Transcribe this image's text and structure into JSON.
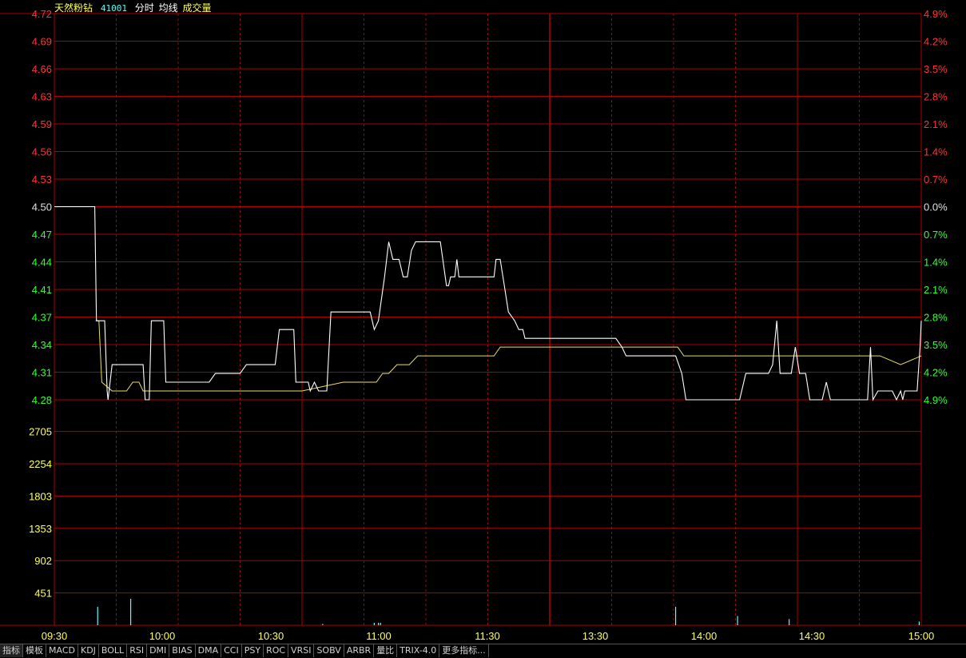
{
  "header": {
    "name": "天然粉钻",
    "code": "41001",
    "legend_intraday": "分时",
    "legend_avg": "均线",
    "legend_volume": "成交量"
  },
  "colors": {
    "grid": "#b00000",
    "price_up": "#ff3333",
    "price_down": "#33ff33",
    "base": "#e0e0e0",
    "volume_axis": "#ffff55",
    "price_line": "#ffffff",
    "avg_line": "#e8e060",
    "volume_bar": "#55ffff"
  },
  "tabs": [
    "指标",
    "模板",
    "MACD",
    "KDJ",
    "BOLL",
    "RSI",
    "DMI",
    "BIAS",
    "DMA",
    "CCI",
    "PSY",
    "ROC",
    "VRSI",
    "SOBV",
    "ARBR",
    "量比",
    "TRIX-4.0",
    "更多指标..."
  ],
  "chart_data": {
    "type": "line",
    "time_labels": [
      "09:30",
      "10:00",
      "10:30",
      "11:00",
      "11:30",
      "13:30",
      "14:00",
      "14:30",
      "15:00"
    ],
    "price_axis": {
      "ticks": [
        "4.72",
        "4.69",
        "4.66",
        "4.63",
        "4.59",
        "4.56",
        "4.53",
        "4.50",
        "4.47",
        "4.44",
        "4.41",
        "4.37",
        "4.34",
        "4.31",
        "4.28"
      ],
      "pct_ticks": [
        "4.9%",
        "4.2%",
        "3.5%",
        "2.8%",
        "2.1%",
        "1.4%",
        "0.7%",
        "0.0%",
        "0.7%",
        "1.4%",
        "2.1%",
        "2.8%",
        "3.5%",
        "4.2%",
        "4.9%"
      ],
      "base": 4.5,
      "ylim": [
        4.28,
        4.72
      ]
    },
    "volume_axis": {
      "ticks": [
        "2705",
        "2254",
        "1803",
        "1353",
        "902",
        "451"
      ],
      "ylim": [
        0,
        3156
      ]
    },
    "series": [
      {
        "values": [
          [
            0,
            4.5
          ],
          [
            9.8,
            4.5
          ],
          [
            10.2,
            4.37
          ],
          [
            12.2,
            4.37
          ],
          [
            12.8,
            4.29
          ],
          [
            13,
            4.28
          ],
          [
            14,
            4.32
          ],
          [
            21.5,
            4.32
          ],
          [
            22,
            4.28
          ],
          [
            23,
            4.28
          ],
          [
            23.5,
            4.37
          ],
          [
            26.5,
            4.37
          ],
          [
            27,
            4.3
          ],
          [
            37.5,
            4.3
          ],
          [
            39,
            4.31
          ],
          [
            45,
            4.31
          ],
          [
            46.5,
            4.32
          ],
          [
            53.5,
            4.32
          ],
          [
            54.5,
            4.36
          ],
          [
            58,
            4.36
          ],
          [
            58.5,
            4.3
          ],
          [
            61.5,
            4.3
          ],
          [
            62,
            4.29
          ],
          [
            63,
            4.3
          ],
          [
            64,
            4.29
          ],
          [
            66,
            4.29
          ],
          [
            67,
            4.38
          ],
          [
            76.5,
            4.38
          ],
          [
            77.5,
            4.36
          ],
          [
            78.5,
            4.37
          ],
          [
            80,
            4.42
          ],
          [
            81,
            4.46
          ],
          [
            82,
            4.44
          ],
          [
            83.5,
            4.44
          ],
          [
            84.5,
            4.42
          ],
          [
            85.5,
            4.42
          ],
          [
            86.5,
            4.45
          ],
          [
            87.5,
            4.46
          ],
          [
            93.5,
            4.46
          ],
          [
            95,
            4.41
          ],
          [
            95.5,
            4.41
          ],
          [
            96,
            4.42
          ],
          [
            97,
            4.42
          ],
          [
            97.5,
            4.44
          ],
          [
            98,
            4.42
          ],
          [
            106.5,
            4.42
          ],
          [
            107,
            4.44
          ],
          [
            108,
            4.44
          ],
          [
            109,
            4.41
          ],
          [
            110,
            4.38
          ],
          [
            111.5,
            4.37
          ],
          [
            112.5,
            4.36
          ],
          [
            113.5,
            4.36
          ],
          [
            114,
            4.35
          ],
          [
            136,
            4.35
          ],
          [
            137.5,
            4.34
          ],
          [
            138.5,
            4.33
          ],
          [
            150.5,
            4.33
          ],
          [
            152,
            4.31
          ],
          [
            153,
            4.28
          ],
          [
            166,
            4.28
          ],
          [
            167.5,
            4.31
          ],
          [
            173,
            4.31
          ],
          [
            174,
            4.32
          ],
          [
            175,
            4.37
          ],
          [
            175.8,
            4.31
          ],
          [
            178.5,
            4.31
          ],
          [
            179.5,
            4.34
          ],
          [
            180.5,
            4.31
          ],
          [
            182,
            4.31
          ],
          [
            183,
            4.28
          ],
          [
            186,
            4.28
          ],
          [
            187,
            4.3
          ],
          [
            188,
            4.28
          ],
          [
            197,
            4.28
          ],
          [
            197.7,
            4.34
          ],
          [
            198.3,
            4.28
          ],
          [
            199.5,
            4.29
          ],
          [
            203,
            4.29
          ],
          [
            204,
            4.28
          ],
          [
            205,
            4.29
          ],
          [
            205.5,
            4.28
          ],
          [
            206,
            4.29
          ],
          [
            209,
            4.29
          ],
          [
            209.7,
            4.34
          ],
          [
            210,
            4.37
          ]
        ]
      },
      {
        "values": [
          [
            10,
            4.37
          ],
          [
            10.8,
            4.37
          ],
          [
            11.5,
            4.3
          ],
          [
            14,
            4.29
          ],
          [
            16,
            4.29
          ],
          [
            17.5,
            4.29
          ],
          [
            19,
            4.3
          ],
          [
            20.5,
            4.3
          ],
          [
            21.5,
            4.29
          ],
          [
            23,
            4.29
          ],
          [
            23.5,
            4.29
          ],
          [
            40,
            4.29
          ],
          [
            60,
            4.29
          ],
          [
            70,
            4.3
          ],
          [
            75,
            4.3
          ],
          [
            78,
            4.3
          ],
          [
            79.5,
            4.31
          ],
          [
            81,
            4.31
          ],
          [
            83,
            4.32
          ],
          [
            86,
            4.32
          ],
          [
            88,
            4.33
          ],
          [
            95,
            4.33
          ],
          [
            105,
            4.33
          ],
          [
            106.5,
            4.33
          ],
          [
            108,
            4.34
          ],
          [
            115,
            4.34
          ],
          [
            130,
            4.34
          ],
          [
            140,
            4.34
          ],
          [
            150,
            4.34
          ],
          [
            151,
            4.34
          ],
          [
            152.5,
            4.33
          ],
          [
            160,
            4.33
          ],
          [
            165,
            4.33
          ],
          [
            166.5,
            4.33
          ],
          [
            175,
            4.33
          ],
          [
            176,
            4.33
          ],
          [
            181,
            4.33
          ],
          [
            190,
            4.33
          ],
          [
            200,
            4.33
          ],
          [
            205,
            4.32
          ],
          [
            210,
            4.33
          ]
        ]
      }
    ],
    "volume": [
      [
        10.5,
        300
      ],
      [
        18.5,
        430
      ],
      [
        65,
        20
      ],
      [
        77.5,
        40
      ],
      [
        78.5,
        40
      ],
      [
        79,
        40
      ],
      [
        150.5,
        300
      ],
      [
        165.5,
        150
      ],
      [
        178,
        100
      ],
      [
        209.5,
        60
      ]
    ],
    "total_minutes": 210,
    "grid": true
  }
}
